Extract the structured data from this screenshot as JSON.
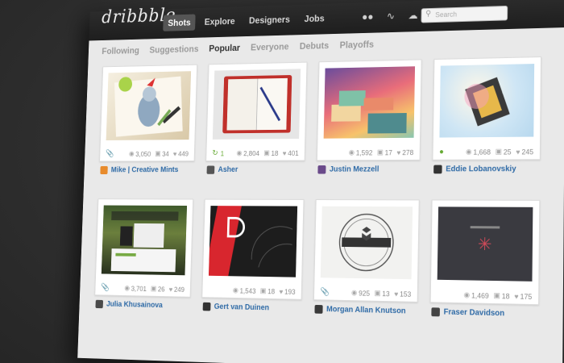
{
  "header": {
    "logo": "dribbble",
    "nav": [
      {
        "label": "Shots",
        "active": true
      },
      {
        "label": "Explore",
        "active": false
      },
      {
        "label": "Designers",
        "active": false
      },
      {
        "label": "Jobs",
        "active": false
      }
    ],
    "icons": [
      "binoculars-icon",
      "activity-icon",
      "cloud-upload-icon"
    ],
    "search_placeholder": "Search"
  },
  "subnav": [
    {
      "label": "Following",
      "active": false
    },
    {
      "label": "Suggestions",
      "active": false
    },
    {
      "label": "Popular",
      "active": true
    },
    {
      "label": "Everyone",
      "active": false
    },
    {
      "label": "Debuts",
      "active": false
    },
    {
      "label": "Playoffs",
      "active": false
    }
  ],
  "shots": [
    {
      "views": "3,050",
      "comments": "34",
      "likes": "449",
      "author": "Mike | Creative Mints",
      "marker": "attachment",
      "avatar_color": "#e88b2c"
    },
    {
      "views": "2,804",
      "comments": "18",
      "likes": "401",
      "author": "Asher",
      "marker": "rebound",
      "rebounds": "1",
      "avatar_color": "#555555"
    },
    {
      "views": "1,592",
      "comments": "17",
      "likes": "278",
      "author": "Justin Mezzell",
      "marker": "none",
      "avatar_color": "#6a4a8a"
    },
    {
      "views": "1,668",
      "comments": "25",
      "likes": "245",
      "author": "Eddie Lobanovskiy",
      "marker": "rebound-dot",
      "avatar_color": "#333333"
    },
    {
      "views": "3,701",
      "comments": "26",
      "likes": "249",
      "author": "Julia Khusainova",
      "marker": "attachment",
      "avatar_color": "#4a4a4a"
    },
    {
      "views": "1,543",
      "comments": "18",
      "likes": "193",
      "author": "Gert van Duinen",
      "marker": "none",
      "avatar_color": "#333333"
    },
    {
      "views": "925",
      "comments": "13",
      "likes": "153",
      "author": "Morgan Allan Knutson",
      "marker": "attachment",
      "avatar_color": "#3a3a3a"
    },
    {
      "views": "1,469",
      "comments": "18",
      "likes": "175",
      "author": "Fraser Davidson",
      "marker": "none",
      "avatar_color": "#444444"
    }
  ]
}
